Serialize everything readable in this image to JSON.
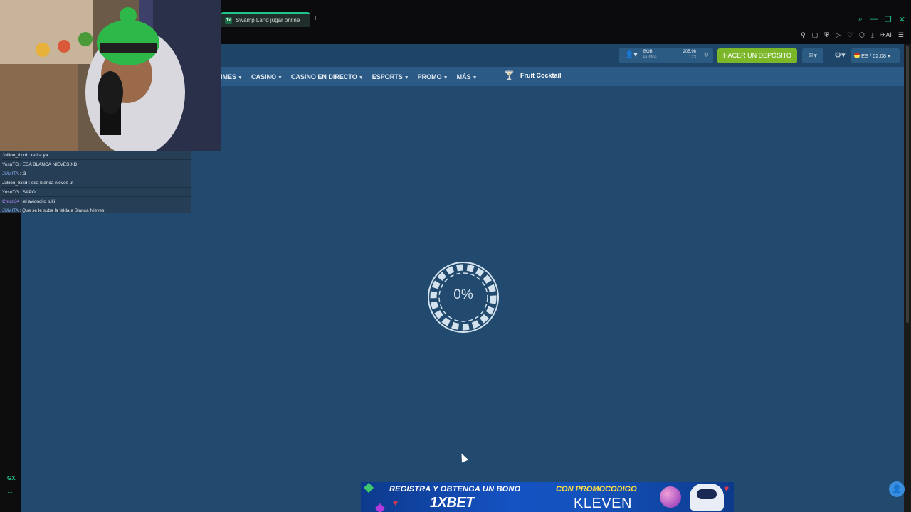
{
  "browser": {
    "tab_title": "Swamp Land jugar online",
    "tab_favicon": "1x",
    "new_tab": "+",
    "window_controls": [
      "search-icon",
      "minimize-icon",
      "restore-icon",
      "close-icon"
    ],
    "toolbar_icons": [
      "pin-icon",
      "snapshot-icon",
      "shield-icon",
      "play-icon",
      "heart-icon",
      "extensions-icon",
      "download-icon",
      "ai-icon",
      "menu-icon"
    ],
    "ai_label": "AI"
  },
  "sidebar": {
    "gx_label": "GX",
    "more": "···"
  },
  "site": {
    "account": {
      "currency": "BOB",
      "points_label": "Puntos",
      "balance": "205.96",
      "points": "123"
    },
    "deposit_label": "HACER UN DEPÓSITO",
    "lang_time": "ES / 02:08",
    "nav": [
      "IMES",
      "CASINO",
      "CASINO EN DIRECTO",
      "ESPORTS",
      "PROMO",
      "MÁS"
    ],
    "game_title": "Fruit Cocktail"
  },
  "loader": {
    "percent": "0%"
  },
  "chat": [
    {
      "user": "Juliioo_fixxd",
      "text": "retira ya",
      "color": "default"
    },
    {
      "user": "YosuTG",
      "text": "ESA BLANCA NIEVES XD",
      "color": "default"
    },
    {
      "user": "JUMITA",
      "text": ":3",
      "color": "blue"
    },
    {
      "user": "Juliioo_fixxd",
      "text": "esa blanca nieves uf",
      "color": "default"
    },
    {
      "user": "YosuTG",
      "text": "SAPO",
      "color": "default"
    },
    {
      "user": "Chubi34",
      "text": "el avioncito tuki",
      "color": "purple"
    },
    {
      "user": "JUMITA",
      "text": "Que se le suba la falda a Blanca Nieves",
      "color": "blue"
    }
  ],
  "ad": {
    "left_line": "REGISTRA Y OBTENGA UN BONO",
    "brand": "1XBET",
    "right_line": "CON PROMOCODIGO",
    "code": "KLEVEN"
  },
  "colors": {
    "site_bg": "#224a6e",
    "deposit": "#7cb72a",
    "accent": "#22c58b"
  }
}
